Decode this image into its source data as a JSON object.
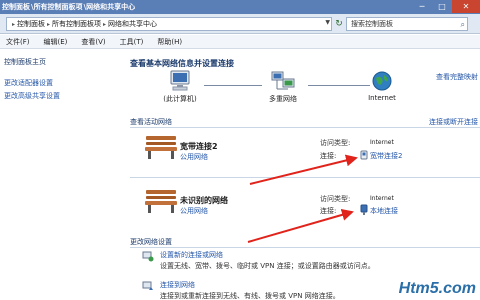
{
  "window": {
    "title_segments": [
      "控制面板",
      "所有控制面板项",
      "网络和共享中心"
    ],
    "close_glyph": "✕",
    "minimize_glyph": "─",
    "maximize_glyph": "□"
  },
  "address_bar": {
    "breadcrumb": [
      "控制面板",
      "所有控制面板项",
      "网络和共享中心"
    ],
    "separator": "▸",
    "search_placeholder": "搜索控制面板"
  },
  "menu": [
    "文件(F)",
    "编辑(E)",
    "查看(V)",
    "工具(T)",
    "帮助(H)"
  ],
  "sidebar": {
    "home": "控制面板主页",
    "links": [
      "更改适配器设置",
      "更改高级共享设置"
    ]
  },
  "main": {
    "basic_heading": "查看基本网络信息并设置连接",
    "full_map_link": "查看完整映射",
    "network_map": {
      "nodes": [
        {
          "label": "(此计算机)",
          "icon": "computer-icon"
        },
        {
          "label": "多重网络",
          "icon": "multiple-networks-icon"
        },
        {
          "label": "Internet",
          "icon": "globe-icon"
        }
      ]
    },
    "active_heading": "查看活动网络",
    "connect_link": "连接或断开连接",
    "networks": [
      {
        "name": "宽带连接2",
        "type": "公用网络",
        "access_type_label": "访问类型:",
        "access_type": "Internet",
        "connection_label": "连接:",
        "connection": "宽带连接2",
        "icon": "bench-icon",
        "connection_icon": "dialup-icon"
      },
      {
        "name": "未识别的网络",
        "type": "公用网络",
        "access_type_label": "访问类型:",
        "access_type": "Internet",
        "connection_label": "连接:",
        "connection": "本地连接",
        "icon": "bench-icon",
        "connection_icon": "ethernet-icon"
      }
    ],
    "change_heading": "更改网络设置",
    "tasks": [
      {
        "title": "设置新的连接或网络",
        "desc": "设置无线、宽带、拨号、临时或 VPN 连接；或设置路由器或访问点。"
      },
      {
        "title": "连接到网络",
        "desc": "连接到或重新连接到无线、有线、拨号或 VPN 网络连接。"
      }
    ]
  },
  "watermark": "Htm5.com",
  "colors": {
    "titlebar": "#5a7eb6",
    "link": "#2456a8",
    "annotation_arrow": "#e0231b"
  }
}
